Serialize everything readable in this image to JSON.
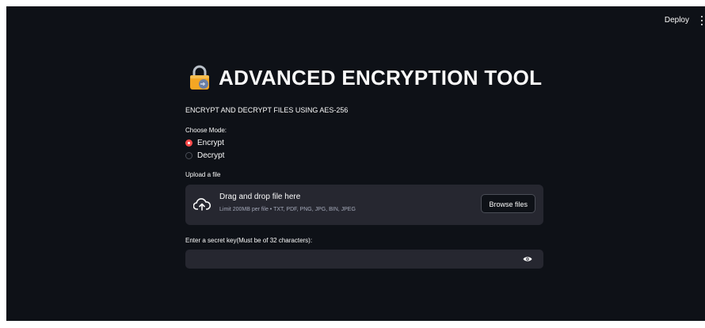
{
  "header": {
    "deploy_label": "Deploy",
    "menu_icon": "more-vert-icon"
  },
  "main": {
    "title_icon": "lock-icon",
    "title": "ADVANCED ENCRYPTION TOOL",
    "subtitle": "ENCRYPT AND DECRYPT FILES USING AES-256",
    "mode": {
      "label": "Choose Mode:",
      "options": [
        "Encrypt",
        "Decrypt"
      ],
      "selected": "Encrypt"
    },
    "upload": {
      "label": "Upload a file",
      "icon": "cloud-upload-icon",
      "drop_text": "Drag and drop file here",
      "limit_text": "Limit 200MB per file • TXT, PDF, PNG, JPG, BIN, JPEG",
      "browse_label": "Browse files"
    },
    "secret_key": {
      "label": "Enter a secret key(Must be of 32 characters):",
      "value": "",
      "icon": "eye-icon"
    }
  },
  "colors": {
    "background": "#0e1117",
    "panel": "#262730",
    "accent": "#ff4b4b",
    "text": "#fafafa"
  }
}
